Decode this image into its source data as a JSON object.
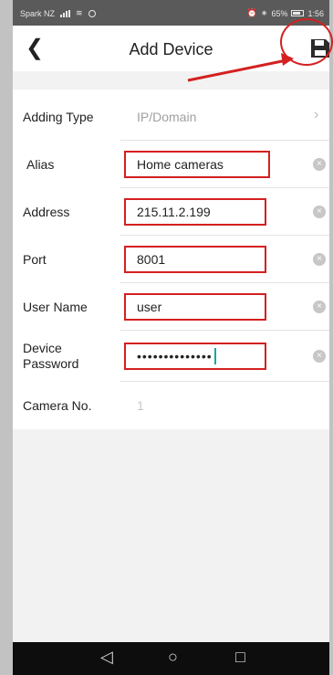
{
  "status_bar": {
    "carrier": "Spark NZ",
    "battery": "65%",
    "time": "1:56"
  },
  "header": {
    "back_icon": "chevron-left-icon",
    "title": "Add Device",
    "save_icon": "floppy-disk-icon"
  },
  "form": {
    "adding_type": {
      "label": "Adding Type",
      "value": "IP/Domain"
    },
    "alias": {
      "label": "Alias",
      "value": "Home cameras"
    },
    "address": {
      "label": "Address",
      "value": "215.11.2.199"
    },
    "port": {
      "label": "Port",
      "value": "8001"
    },
    "user_name": {
      "label": "User Name",
      "value": "user"
    },
    "password": {
      "label": "Device Password",
      "masked": "••••••••••••••"
    },
    "camera_no": {
      "label": "Camera No.",
      "value": "1"
    }
  },
  "colors": {
    "annotation_red": "#d42020",
    "caret": "#1aa5a5"
  },
  "nav": {
    "back": "◁",
    "home": "○",
    "recents": "□"
  }
}
